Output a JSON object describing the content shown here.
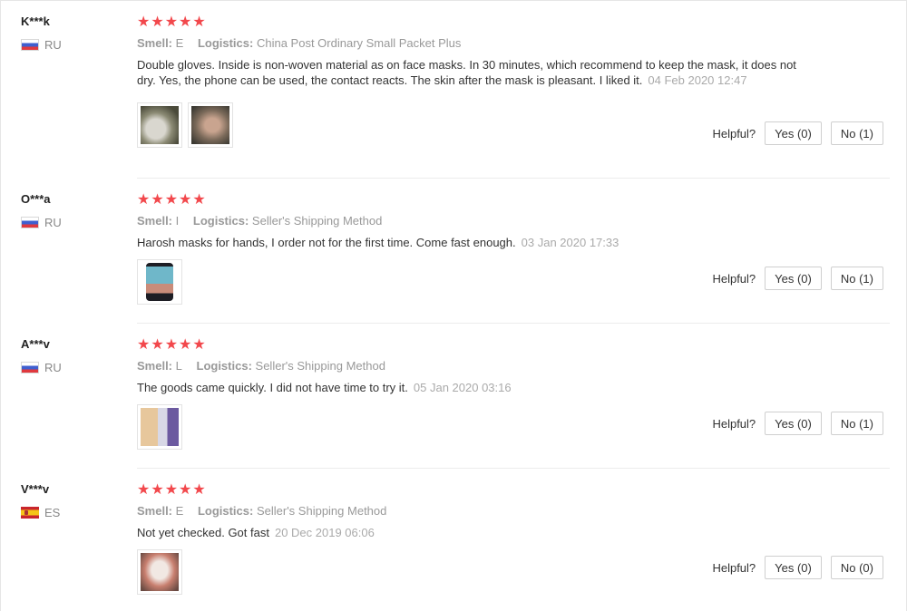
{
  "reviews": [
    {
      "user": "K***k",
      "country": "RU",
      "flag": "russia-flag",
      "stars": 5,
      "smell_label": "Smell:",
      "smell_value": "E",
      "logistics_label": "Logistics:",
      "logistics_value": "China Post Ordinary Small Packet Plus",
      "text": "Double gloves. Inside is non-woven material as on face masks. In 30 minutes, which recommend to keep the mask, it does not dry. Yes, the phone can be used, the contact reacts. The skin after the mask is pleasant. I liked it.",
      "date": "04 Feb 2020 12:47",
      "photos": [
        "photo-1",
        "photo-2"
      ],
      "helpful_label": "Helpful?",
      "yes_label": "Yes (0)",
      "no_label": "No (1)"
    },
    {
      "user": "O***a",
      "country": "RU",
      "flag": "russia-flag",
      "stars": 5,
      "smell_label": "Smell:",
      "smell_value": "I",
      "logistics_label": "Logistics:",
      "logistics_value": "Seller's Shipping Method",
      "text": "Harosh masks for hands, I order not for the first time. Come fast enough.",
      "date": "03 Jan 2020 17:33",
      "photos": [
        "photo-1"
      ],
      "helpful_label": "Helpful?",
      "yes_label": "Yes (0)",
      "no_label": "No (1)"
    },
    {
      "user": "A***v",
      "country": "RU",
      "flag": "russia-flag",
      "stars": 5,
      "smell_label": "Smell:",
      "smell_value": "L",
      "logistics_label": "Logistics:",
      "logistics_value": "Seller's Shipping Method",
      "text": "The goods came quickly. I did not have time to try it.",
      "date": "05 Jan 2020 03:16",
      "photos": [
        "photo-1"
      ],
      "helpful_label": "Helpful?",
      "yes_label": "Yes (0)",
      "no_label": "No (1)"
    },
    {
      "user": "V***v",
      "country": "ES",
      "flag": "spain-flag",
      "stars": 5,
      "smell_label": "Smell:",
      "smell_value": "E",
      "logistics_label": "Logistics:",
      "logistics_value": "Seller's Shipping Method",
      "text": "Not yet checked. Got fast",
      "date": "20 Dec 2019 06:06",
      "photos": [
        "photo-1"
      ],
      "helpful_label": "Helpful?",
      "yes_label": "Yes (0)",
      "no_label": "No (0)"
    }
  ],
  "star_glyph": "★",
  "colors": {
    "star": "#f2484c",
    "muted": "#999999",
    "text": "#333333"
  }
}
